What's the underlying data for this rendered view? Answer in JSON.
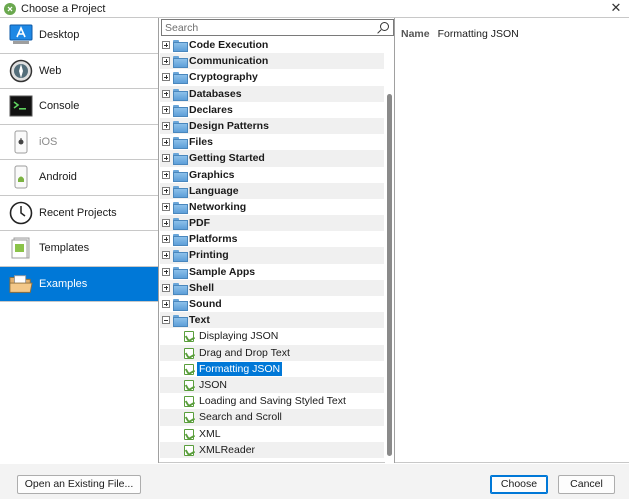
{
  "window": {
    "title": "Choose a Project",
    "close_glyph": "✕"
  },
  "categories": [
    {
      "label": "Desktop",
      "icon": "desktop-app-icon",
      "state": "normal"
    },
    {
      "label": "Web",
      "icon": "globe-icon",
      "state": "normal"
    },
    {
      "label": "Console",
      "icon": "console-icon",
      "state": "normal"
    },
    {
      "label": "iOS",
      "icon": "phone-apple-icon",
      "state": "disabled"
    },
    {
      "label": "Android",
      "icon": "phone-android-icon",
      "state": "normal"
    },
    {
      "label": "Recent Projects",
      "icon": "clock-icon",
      "state": "normal"
    },
    {
      "label": "Templates",
      "icon": "template-icon",
      "state": "normal"
    },
    {
      "label": "Examples",
      "icon": "folder-open-icon",
      "state": "selected"
    }
  ],
  "search": {
    "placeholder": "Search"
  },
  "tree": {
    "folders": [
      "Code Execution",
      "Communication",
      "Cryptography",
      "Databases",
      "Declares",
      "Design Patterns",
      "Files",
      "Getting Started",
      "Graphics",
      "Language",
      "Networking",
      "PDF",
      "Platforms",
      "Printing",
      "Sample Apps",
      "Shell",
      "Sound"
    ],
    "expanded_folder": "Text",
    "text_items": [
      "Displaying JSON",
      "Drag and Drop Text",
      "Formatting JSON",
      "JSON",
      "Loading and Saving Styled Text",
      "Search and Scroll",
      "XML",
      "XMLReader"
    ],
    "selected_item": "Formatting JSON"
  },
  "detail": {
    "name_label": "Name",
    "name_value": "Formatting JSON"
  },
  "footer": {
    "open_existing_label": "Open an Existing File...",
    "choose_label": "Choose",
    "cancel_label": "Cancel"
  },
  "colors": {
    "selection": "#0078d7",
    "folder": "#6aa6d9",
    "doc_icon": "#5a9e3c"
  }
}
